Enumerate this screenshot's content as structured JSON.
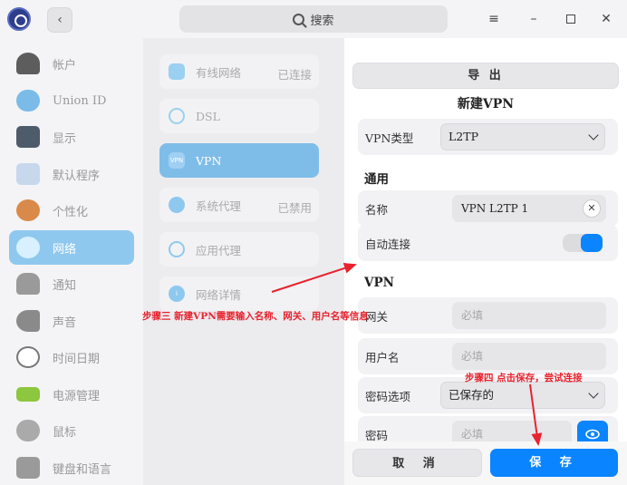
{
  "search": {
    "placeholder": "搜索"
  },
  "sidebar": {
    "items": [
      {
        "label": "帐户",
        "icon": "account-icon",
        "color": "#5d5d5d"
      },
      {
        "label": "Union ID",
        "icon": "cloud-icon",
        "color": "#7bbbe8"
      },
      {
        "label": "显示",
        "icon": "display-icon",
        "color": "#4d5b6a"
      },
      {
        "label": "默认程序",
        "icon": "default-apps-icon",
        "color": "#c8d8ec"
      },
      {
        "label": "个性化",
        "icon": "personalization-icon",
        "color": "#d98a4a"
      },
      {
        "label": "网络",
        "icon": "network-icon",
        "color": "#d8f0ff"
      },
      {
        "label": "通知",
        "icon": "bell-icon",
        "color": "#9a9a9a"
      },
      {
        "label": "声音",
        "icon": "speaker-icon",
        "color": "#8a8a8a"
      },
      {
        "label": "时间日期",
        "icon": "clock-icon",
        "color": "#777777"
      },
      {
        "label": "电源管理",
        "icon": "battery-icon",
        "color": "#8dc63f"
      },
      {
        "label": "鼠标",
        "icon": "mouse-icon",
        "color": "#aaaaaa"
      },
      {
        "label": "键盘和语言",
        "icon": "keyboard-icon",
        "color": "#9a9a9a"
      }
    ]
  },
  "network_list": {
    "items": [
      {
        "label": "有线网络",
        "status": "已连接",
        "icon": "wired-network-icon"
      },
      {
        "label": "DSL",
        "status": "",
        "icon": "dsl-icon"
      },
      {
        "label": "VPN",
        "status": "",
        "icon": "vpn-icon",
        "icon_text": "VPN"
      },
      {
        "label": "系统代理",
        "status": "已禁用",
        "icon": "system-proxy-icon"
      },
      {
        "label": "应用代理",
        "status": "",
        "icon": "app-proxy-icon"
      },
      {
        "label": "网络详情",
        "status": "",
        "icon": "info-icon"
      }
    ]
  },
  "panel": {
    "export_label": "导 出",
    "title": "新建VPN",
    "vpn_type_label": "VPN类型",
    "vpn_type_value": "L2TP",
    "general_title": "通用",
    "name_label": "名称",
    "name_value": "VPN L2TP 1",
    "clear_glyph": "✕",
    "autoconnect_label": "自动连接",
    "autoconnect_on": true,
    "vpn_section_title": "VPN",
    "gateway_label": "网关",
    "gateway_placeholder": "必填",
    "username_label": "用户名",
    "username_placeholder": "必填",
    "password_option_label": "密码选项",
    "password_option_value": "已保存的",
    "password_label": "密码",
    "password_placeholder": "必填",
    "cancel_label": "取 消",
    "save_label": "保 存"
  },
  "annotations": {
    "step3": "步骤三 新建VPN需要输入名称、网关、用户名等信息",
    "step4": "步骤四 点击保存，尝试连接"
  },
  "colors": {
    "accent": "#0a84ff",
    "annotation": "#e8232e",
    "active_sidebar": "#8fc8ef"
  }
}
